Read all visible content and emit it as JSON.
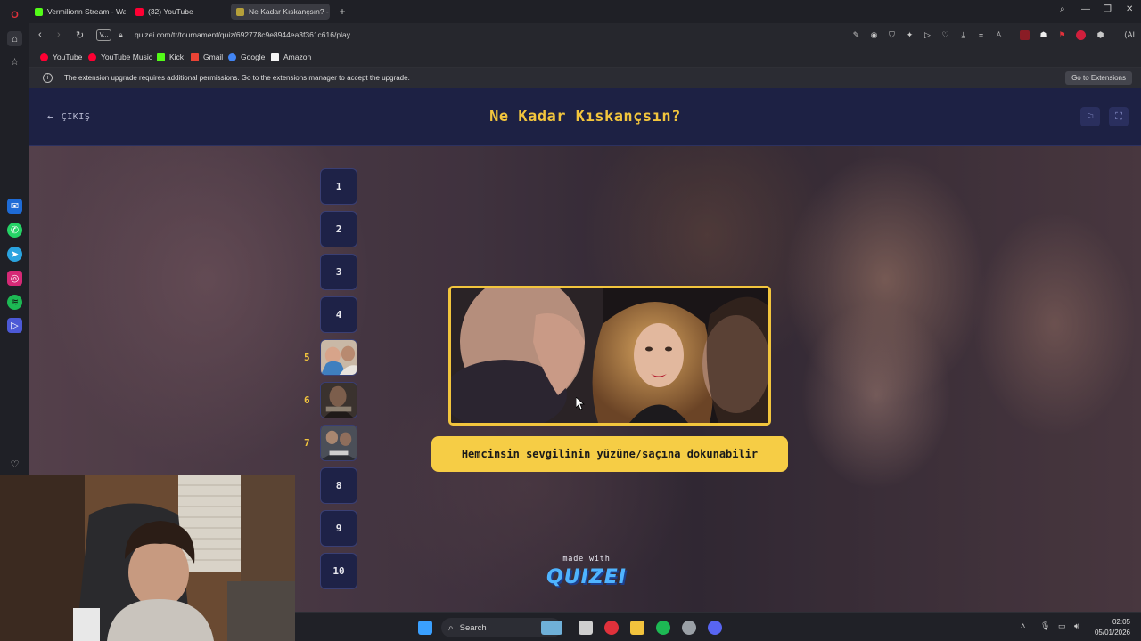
{
  "browser": {
    "tabs": [
      {
        "label": "Vermilionn Stream - Watc",
        "color": "#53fc18"
      },
      {
        "label": "(32) YouTube",
        "color": "#ff0033"
      },
      {
        "label": "Ne Kadar Kıskançsın? - Tir",
        "color": "#b5a03a",
        "active": true
      }
    ],
    "url": "quizei.com/tr/tournament/quiz/692778c9e8944ea3f361c616/play",
    "vbadge": "V...",
    "bookmarks": [
      {
        "label": "YouTube",
        "color": "#ff0033"
      },
      {
        "label": "YouTube Music",
        "color": "#ff0033"
      },
      {
        "label": "Kick",
        "color": "#53fc18"
      },
      {
        "label": "Gmail",
        "color": "#ea4335"
      },
      {
        "label": "Google",
        "color": "#4285f4"
      },
      {
        "label": "Amazon",
        "color": "#f4f4f4"
      }
    ],
    "notice": {
      "message": "The extension upgrade requires additional permissions. Go to the extensions manager to accept the upgrade.",
      "button": "Go to Extensions"
    }
  },
  "quiz": {
    "exit_label": "ÇIKIŞ",
    "title": "Ne Kadar Kıskançsın?",
    "numbers": [
      "1",
      "2",
      "3",
      "4",
      "5",
      "6",
      "7",
      "8",
      "9",
      "10"
    ],
    "side_labels": [
      "5",
      "6",
      "7"
    ],
    "caption": "Hemcinsin sevgilinin yüzüne/saçına dokunabilir",
    "made_with": "made with",
    "brand": "QUIZEI",
    "accent": "#f2c53d"
  },
  "taskbar": {
    "search_placeholder": "Search",
    "time": "02:05",
    "date": "05/01/2026"
  }
}
